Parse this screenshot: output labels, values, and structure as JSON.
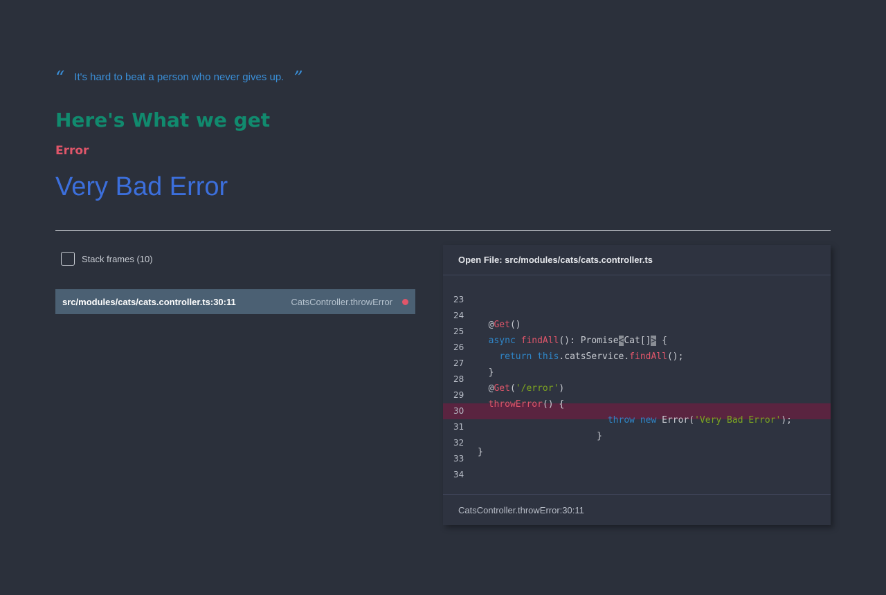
{
  "quote": {
    "open_mark": "“",
    "text": "It's hard to beat a person who never gives up.",
    "close_mark": "”"
  },
  "header": {
    "title": "Here's What we get",
    "error_label": "Error",
    "error_message": "Very Bad Error"
  },
  "frames": {
    "toggle_label": "Stack frames (10)",
    "items": [
      {
        "file": "src/modules/cats/cats.controller.ts:30:11",
        "method": "CatsController.throwError"
      }
    ]
  },
  "code_panel": {
    "header": "Open File: src/modules/cats/cats.controller.ts",
    "footer": "CatsController.throwError:30:11",
    "highlight_line": 30,
    "lines": [
      {
        "n": "23",
        "code": ""
      },
      {
        "n": "24",
        "code": ""
      },
      {
        "n": "25",
        "code": "  @Get()"
      },
      {
        "n": "26",
        "code": "  async findAll(): Promise<Cat[]> {"
      },
      {
        "n": "27",
        "code": "    return this.catsService.findAll();"
      },
      {
        "n": "28",
        "code": "  }"
      },
      {
        "n": "29",
        "code": "  @Get('/error')"
      },
      {
        "n": "30",
        "code": "  throwError() {"
      },
      {
        "n": "31",
        "code": "                        throw new Error('Very Bad Error');"
      },
      {
        "n": "32",
        "code": "                      }"
      },
      {
        "n": "33",
        "code": "}"
      },
      {
        "n": "34",
        "code": ""
      }
    ]
  },
  "colors": {
    "background": "#2b303b",
    "title": "#118a6e",
    "error": "#e0566a",
    "message": "#3c6fdc",
    "quote": "#3a8fd8",
    "highlight": "#5a2440"
  }
}
